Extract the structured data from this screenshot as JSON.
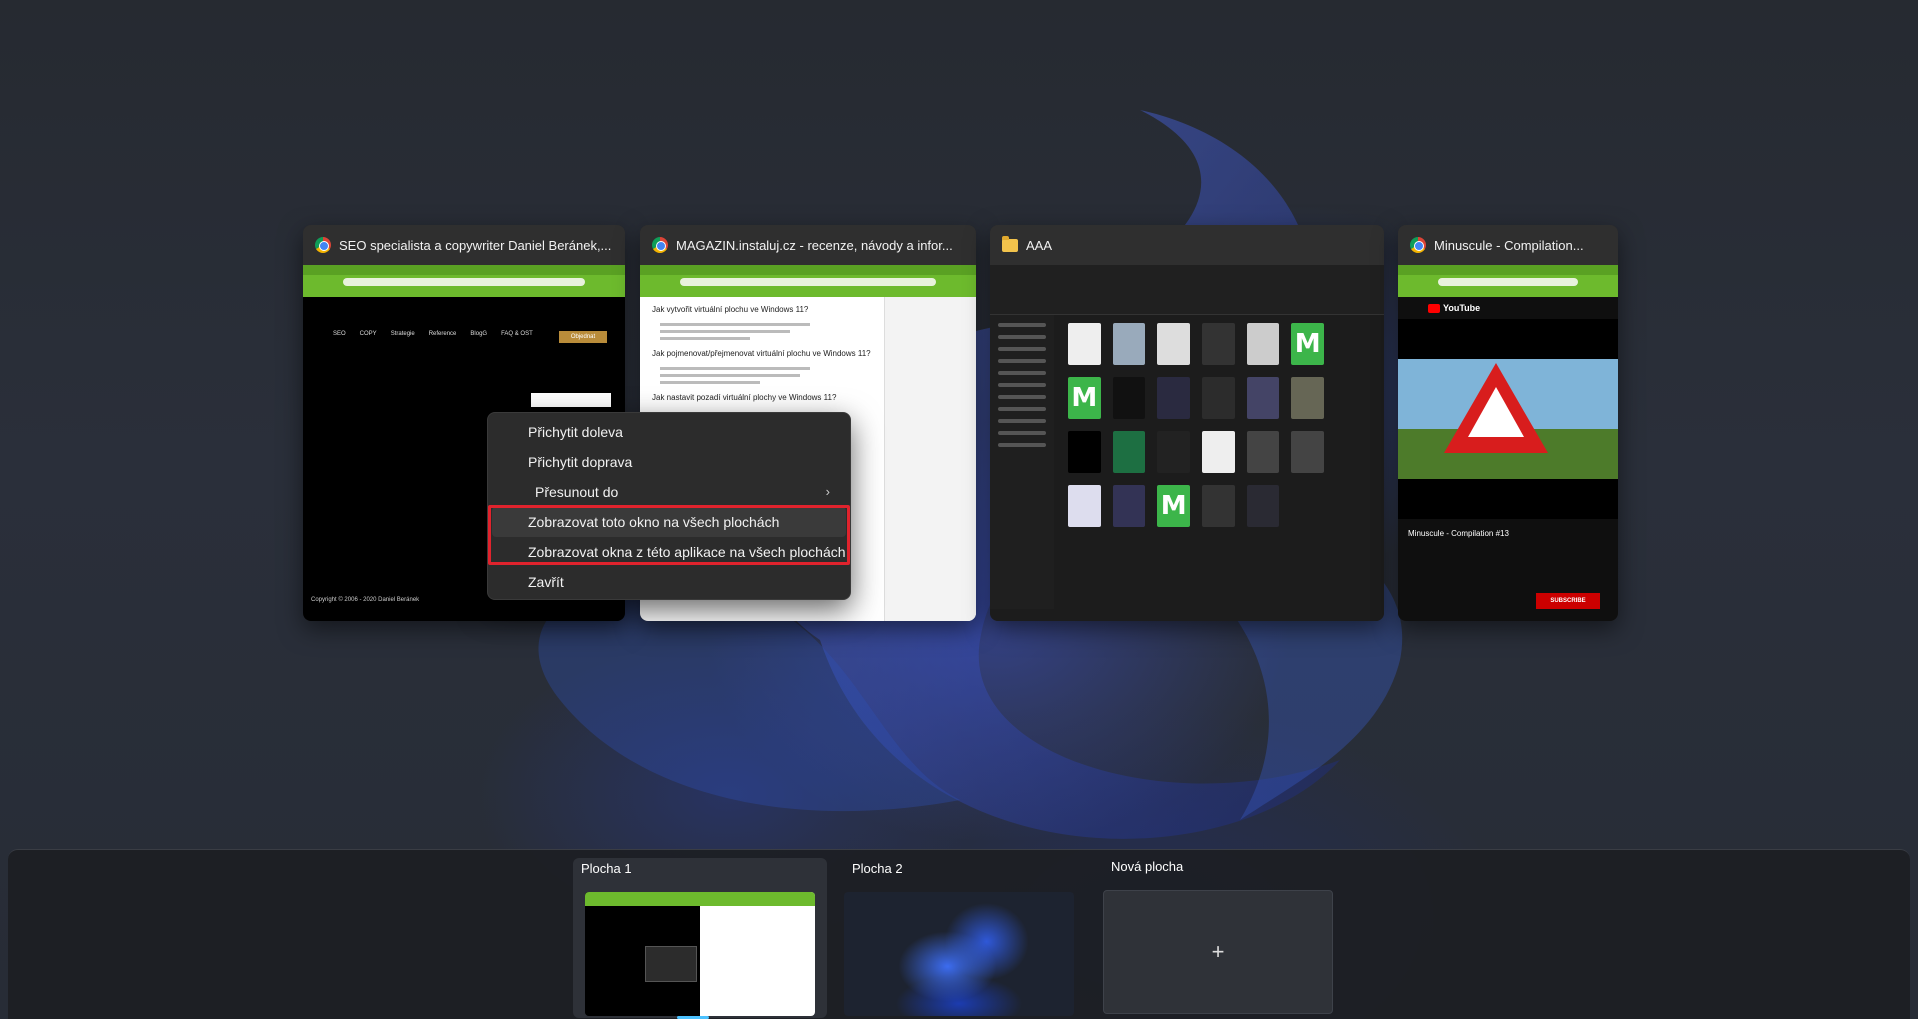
{
  "windows": [
    {
      "title": "SEO specialista a copywriter Daniel Beránek,...",
      "icon": "chrome-icon",
      "menu": [
        "SEO",
        "COPY",
        "Strategie",
        "Reference",
        "BlogG",
        "FAQ & OST"
      ],
      "button": "Objednat",
      "footer": "Copyright © 2006 - 2020 Daniel Beránek"
    },
    {
      "title": "MAGAZIN.instaluj.cz - recenze, návody a infor...",
      "icon": "chrome-icon",
      "headings": [
        "Jak vytvořit virtuální plochu ve Windows 11?",
        "Jak pojmenovat/přejmenovat virtuální plochu ve Windows 11?",
        "Jak nastavit pozadí virtuální plochy ve Windows 11?"
      ]
    },
    {
      "title": "AAA",
      "icon": "folder-icon"
    },
    {
      "title": "Minuscule - Compilation...",
      "icon": "chrome-icon",
      "yt_label": "YouTube",
      "video_title": "Minuscule - Compilation #13",
      "subscribe": "SUBSCRIBE"
    }
  ],
  "context_menu": {
    "items": [
      {
        "label": "Přichytit doleva"
      },
      {
        "label": "Přichytit doprava"
      },
      {
        "label": "Přesunout do",
        "submenu": true
      },
      {
        "label": "Zobrazovat toto okno na všech plochách"
      },
      {
        "label": "Zobrazovat okna z této aplikace na všech plochách"
      },
      {
        "label": "Zavřít"
      }
    ],
    "highlight_color": "#e0232d"
  },
  "desktops": {
    "items": [
      {
        "label": "Plocha 1",
        "active": true
      },
      {
        "label": "Plocha 2",
        "active": false
      }
    ],
    "new_label": "Nová plocha",
    "accent": "#4cc2ff"
  }
}
